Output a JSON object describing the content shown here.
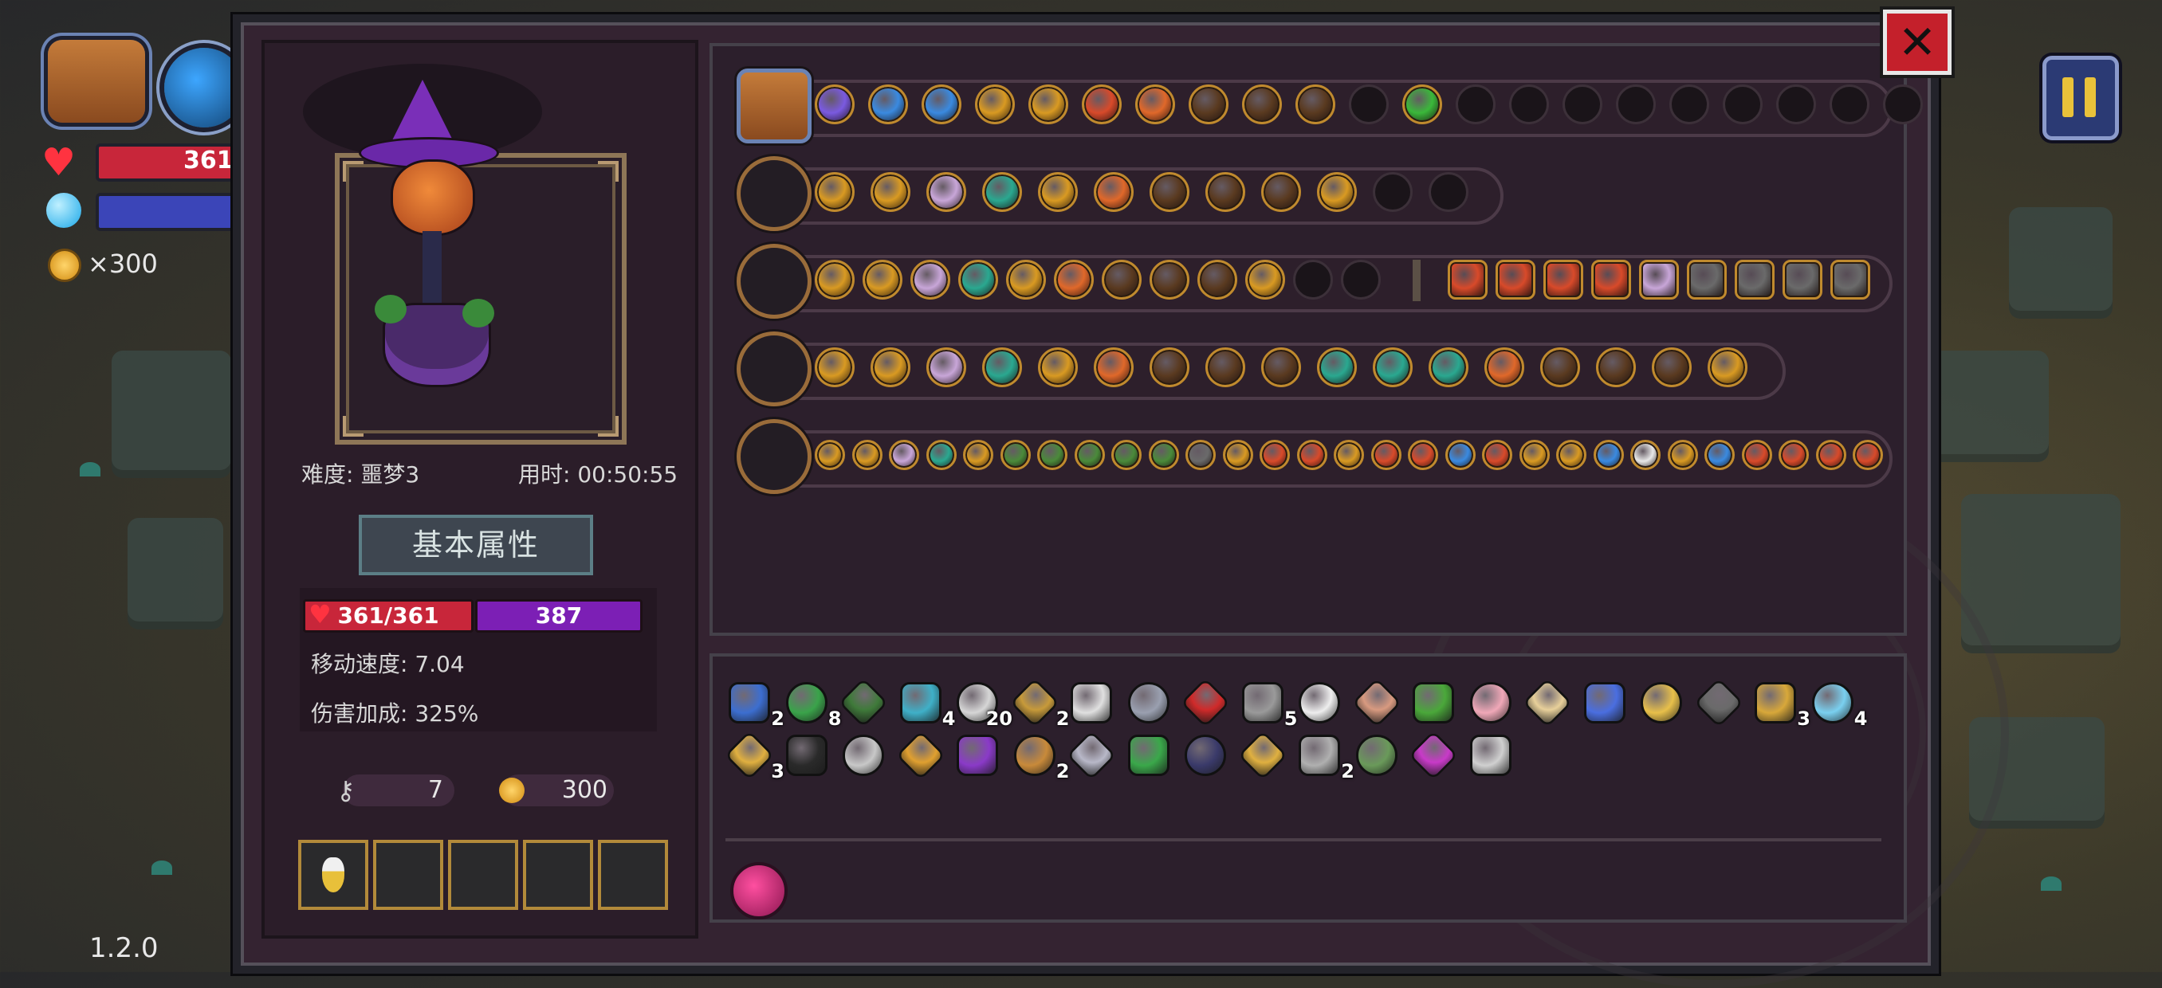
{
  "hud": {
    "hp_text": "361/",
    "coins": "×300",
    "version": "1.2.0"
  },
  "character": {
    "difficulty": "难度: 噩梦3",
    "time": "用时: 00:50:55",
    "section_title": "基本属性",
    "hp": "361/361",
    "mp": "387",
    "move_speed": "移动速度: 7.04",
    "damage_bonus": "伤害加成: 325%",
    "keys": "7",
    "gold": "300",
    "quick_slots": [
      "potion",
      "",
      "",
      "",
      ""
    ]
  },
  "skill_rows": [
    {
      "weapon": "bag-icon",
      "chips": [
        "purple",
        "blue",
        "blue",
        "gold",
        "gold",
        "red",
        "orange",
        "orange-dim",
        "orange-dim",
        "orange-dim",
        "empty",
        "green-skull",
        "empty",
        "empty",
        "empty",
        "empty",
        "empty",
        "empty",
        "empty",
        "empty",
        "empty"
      ]
    },
    {
      "weapon": "shotgun-icon",
      "chips": [
        "gold",
        "gold",
        "pink",
        "teal",
        "gold",
        "orange",
        "orange-dim",
        "orange-dim",
        "orange-dim",
        "gold",
        "empty",
        "empty"
      ]
    },
    {
      "weapon": "dark-staff-icon",
      "chips": [
        "gold",
        "gold",
        "pink",
        "teal",
        "gold",
        "orange",
        "orange-dim",
        "orange-dim",
        "orange-dim",
        "gold",
        "empty",
        "empty"
      ],
      "extra": [
        "red",
        "red",
        "red",
        "red",
        "pink",
        "grey",
        "grey",
        "grey",
        "grey"
      ]
    },
    {
      "weapon": "golden-staff-icon",
      "chips": [
        "gold",
        "gold",
        "pink",
        "teal",
        "gold",
        "orange",
        "orange-dim",
        "orange-dim",
        "orange-dim",
        "teal",
        "teal",
        "teal",
        "orange",
        "orange-dim",
        "orange-dim",
        "orange-dim",
        "gold"
      ]
    },
    {
      "weapon": "crystal-wand-icon",
      "chips": [
        "gold",
        "gold",
        "pink",
        "teal",
        "gold",
        "green",
        "green",
        "green",
        "green",
        "green",
        "grey",
        "gold",
        "red",
        "red",
        "gold",
        "red",
        "red",
        "blue",
        "red",
        "gold",
        "gold",
        "blue",
        "white",
        "gold",
        "blue",
        "red",
        "red",
        "red",
        "red"
      ]
    }
  ],
  "inventory": [
    {
      "icon": "blue-squid",
      "qty": "2",
      "color": "#3c6ed0"
    },
    {
      "icon": "green-arrow",
      "qty": "8",
      "color": "#3aa34a"
    },
    {
      "icon": "green-belt",
      "qty": "",
      "color": "#3f7a3a"
    },
    {
      "icon": "cyan-arrow",
      "qty": "4",
      "color": "#3fb0c8"
    },
    {
      "icon": "white-arrow",
      "qty": "20",
      "color": "#d6d6d6"
    },
    {
      "icon": "pickaxe",
      "qty": "2",
      "color": "#c79a3a"
    },
    {
      "icon": "claw",
      "qty": "",
      "color": "#e0e0e0"
    },
    {
      "icon": "bar",
      "qty": "",
      "color": "#9aa0b0"
    },
    {
      "icon": "red-demon",
      "qty": "",
      "color": "#d02a2a"
    },
    {
      "icon": "grey-arrow",
      "qty": "5",
      "color": "#9a9a9a"
    },
    {
      "icon": "feather-wing",
      "qty": "",
      "color": "#eeeeee"
    },
    {
      "icon": "egg-stone",
      "qty": "",
      "color": "#d89a80"
    },
    {
      "icon": "green-sprout",
      "qty": "",
      "color": "#4aa83a"
    },
    {
      "icon": "pink-feather",
      "qty": "",
      "color": "#f0a8b8"
    },
    {
      "icon": "bread",
      "qty": "",
      "color": "#e8d09a"
    },
    {
      "icon": "blue-gem",
      "qty": "",
      "color": "#4a6ee0"
    },
    {
      "icon": "cone",
      "qty": "",
      "color": "#e8c04a"
    },
    {
      "icon": "grey-beast",
      "qty": "",
      "color": "#6a6a6a"
    },
    {
      "icon": "gold-trident",
      "qty": "3",
      "color": "#d8a83a"
    },
    {
      "icon": "ice-arrow",
      "qty": "4",
      "color": "#7ad0f0"
    },
    {
      "icon": "gold-arrow",
      "qty": "3",
      "color": "#e0b040"
    },
    {
      "icon": "black-hood",
      "qty": "",
      "color": "#2a2a2a"
    },
    {
      "icon": "heart-armor",
      "qty": "",
      "color": "#c8c8c8"
    },
    {
      "icon": "gold-cup",
      "qty": "",
      "color": "#e0a030"
    },
    {
      "icon": "witch-hat",
      "qty": "",
      "color": "#8a3ac8"
    },
    {
      "icon": "hourglass",
      "qty": "2",
      "color": "#c88a3a"
    },
    {
      "icon": "silver-boot",
      "qty": "",
      "color": "#b8b8c8"
    },
    {
      "icon": "green-hand",
      "qty": "",
      "color": "#3aa84a"
    },
    {
      "icon": "dark-cloak",
      "qty": "",
      "color": "#3a3a6a"
    },
    {
      "icon": "gold-glove",
      "qty": "",
      "color": "#e0b040"
    },
    {
      "icon": "hook",
      "qty": "2",
      "color": "#b0b0b0"
    },
    {
      "icon": "green-bone",
      "qty": "",
      "color": "#6a9a5a"
    },
    {
      "icon": "rainbow-cape",
      "qty": "",
      "color": "#c83ac8"
    },
    {
      "icon": "magnifier",
      "qty": "",
      "color": "#d0d0d0"
    }
  ],
  "colors": {
    "gold": "#d99a22",
    "orange": "#e0682a",
    "orange-dim": "#5a3a20",
    "pink": "#c8a6d8",
    "teal": "#2aa890",
    "blue": "#3a8ae0",
    "purple": "#7a5ae0",
    "red": "#d84a2a",
    "green": "#4a8a3a",
    "grey": "#6a6a6a",
    "white": "#e8e8e8",
    "green-skull": "#3ab83a",
    "empty": "#1a1419"
  }
}
